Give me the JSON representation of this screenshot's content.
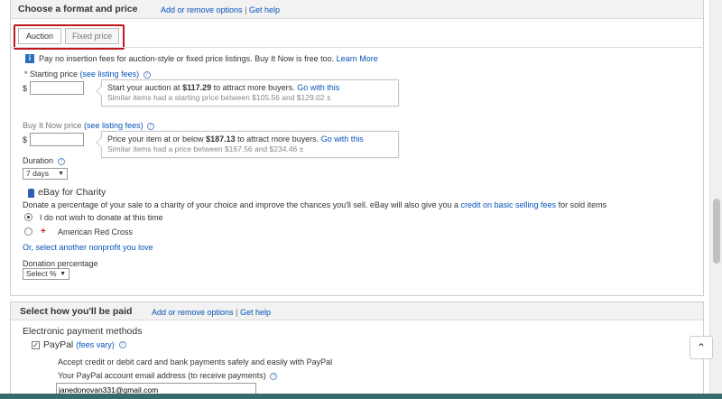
{
  "format_section": {
    "title": "Choose a format and price",
    "add_remove_link": "Add or remove options",
    "separator": "|",
    "help_link": "Get help",
    "tabs": [
      {
        "label": "Auction"
      },
      {
        "label": "Fixed price"
      }
    ],
    "info_text": "Pay no insertion fees for auction-style or fixed price listings. Buy It Now is free too.",
    "info_learn_more": "Learn More",
    "starting_price": {
      "label": "* Starting price",
      "fees_link": "(see listing fees)",
      "currency": "$",
      "value": "",
      "tip_main_prefix": "Start your auction at",
      "tip_main_value": "$117.29",
      "tip_main_suffix": "to attract more buyers.",
      "tip_action": "Go with this",
      "tip_sub": "Similar items had a starting price between $105.56 and $129.02 ±"
    },
    "buy_it_now": {
      "label": "Buy It Now price",
      "fees_link": "(see listing fees)",
      "currency": "$",
      "value": "",
      "tip_main_prefix": "Price your item at or below",
      "tip_main_value": "$187.13",
      "tip_main_suffix": "to attract more buyers.",
      "tip_action": "Go with this",
      "tip_sub": "Similar items had a price between $167.56 and $234.46 ±"
    },
    "duration": {
      "label": "Duration",
      "value": "7 days"
    },
    "charity": {
      "title": "eBay for Charity",
      "description": "Donate a percentage of your sale to a charity of your choice and improve the chances you'll sell. eBay will also give you a",
      "credit_link": "credit on basic selling fees",
      "description_end": "for sold items",
      "option_none": "I do not wish to donate at this time",
      "option_redcross": "American Red Cross",
      "redcross_logo": "+",
      "select_other": "Or, select another nonprofit you love",
      "percentage_label": "Donation percentage",
      "percentage_value": "Select %"
    }
  },
  "payment_section": {
    "title": "Select how you'll be paid",
    "add_remove_link": "Add or remove options",
    "separator": "|",
    "help_link": "Get help",
    "electronic_label": "Electronic payment methods",
    "paypal_label": "PayPal",
    "paypal_fees": "(fees vary)",
    "paypal_desc": "Accept credit or debit card and bank payments safely and easily with PayPal",
    "email_label": "Your PayPal account email address (to receive payments)",
    "email_value": "janedonovan331@gmail.com"
  },
  "scroll_up_label": "⌃",
  "colors": {
    "link": "#0654ba",
    "highlight": "#c0151a",
    "bottom_bar": "#3a6b6b"
  }
}
